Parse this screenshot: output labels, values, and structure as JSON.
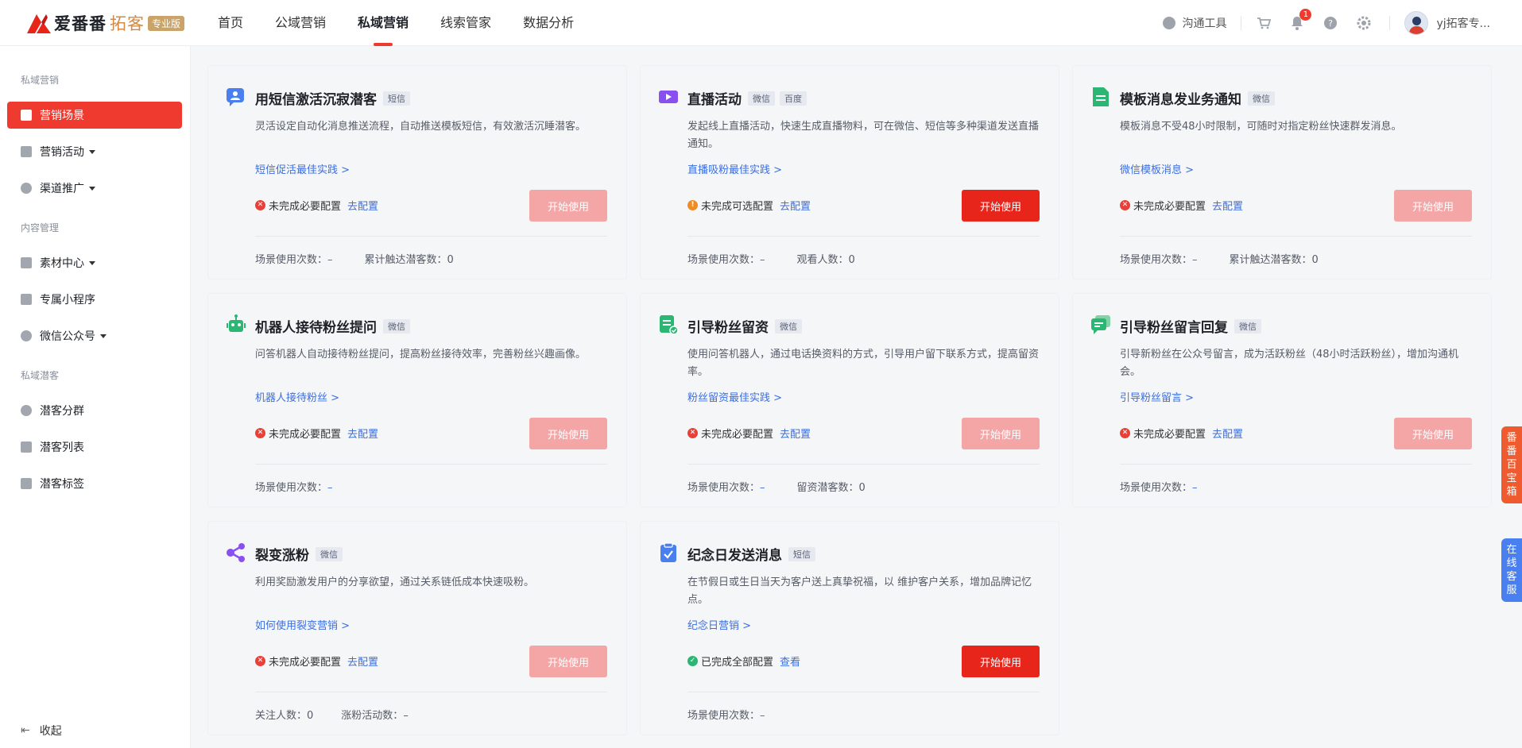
{
  "brand": {
    "name": "爱番番",
    "sub": "拓客",
    "badge": "专业版"
  },
  "nav": [
    "首页",
    "公域营销",
    "私域营销",
    "线索管家",
    "数据分析"
  ],
  "header_right": {
    "tool": "沟通工具",
    "bell_count": "1",
    "user": "yj拓客专..."
  },
  "sidebar": {
    "groups": [
      "私域营销",
      "内容管理",
      "私域潜客"
    ],
    "items": [
      "营销场景",
      "营销活动",
      "渠道推广",
      "素材中心",
      "专属小程序",
      "微信公众号",
      "潜客分群",
      "潜客列表",
      "潜客标签"
    ],
    "collapse": "收起"
  },
  "cards": [
    {
      "title": "用短信激活沉寂潜客",
      "tags": [
        "短信"
      ],
      "desc": "灵活设定自动化消息推送流程，自动推送模板短信，有效激活沉睡潜客。",
      "link": "短信促活最佳实践 >",
      "status": "未完成必要配置",
      "status_link": "去配置",
      "button": "开始使用",
      "stats": [
        {
          "label": "场景使用次数：",
          "value": "–"
        },
        {
          "label": "累计触达潜客数：",
          "value": "0"
        }
      ]
    },
    {
      "title": "直播活动",
      "tags": [
        "微信",
        "百度"
      ],
      "desc": "发起线上直播活动，快速生成直播物料，可在微信、短信等多种渠道发送直播通知。",
      "link": "直播吸粉最佳实践 >",
      "status": "未完成可选配置",
      "status_link": "去配置",
      "button": "开始使用",
      "stats": [
        {
          "label": "场景使用次数：",
          "value": "–"
        },
        {
          "label": "观看人数：",
          "value": "0"
        }
      ]
    },
    {
      "title": "模板消息发业务通知",
      "tags": [
        "微信"
      ],
      "desc": "模板消息不受48小时限制，可随时对指定粉丝快速群发消息。",
      "link": "微信模板消息 >",
      "status": "未完成必要配置",
      "status_link": "去配置",
      "button": "开始使用",
      "stats": [
        {
          "label": "场景使用次数：",
          "value": "–"
        },
        {
          "label": "累计触达潜客数：",
          "value": "0"
        }
      ]
    },
    {
      "title": "机器人接待粉丝提问",
      "tags": [
        "微信"
      ],
      "desc": "问答机器人自动接待粉丝提问，提高粉丝接待效率，完善粉丝兴趣画像。",
      "link": "机器人接待粉丝 >",
      "status": "未完成必要配置",
      "status_link": "去配置",
      "button": "开始使用",
      "stats": [
        {
          "label": "场景使用次数：",
          "value": "–"
        }
      ]
    },
    {
      "title": "引导粉丝留资",
      "tags": [
        "微信"
      ],
      "desc": "使用问答机器人，通过电话换资料的方式，引导用户留下联系方式，提高留资率。",
      "link": "粉丝留资最佳实践 >",
      "status": "未完成必要配置",
      "status_link": "去配置",
      "button": "开始使用",
      "stats": [
        {
          "label": "场景使用次数：",
          "value": "–"
        },
        {
          "label": "留资潜客数：",
          "value": "0"
        }
      ]
    },
    {
      "title": "引导粉丝留言回复",
      "tags": [
        "微信"
      ],
      "desc": "引导新粉丝在公众号留言，成为活跃粉丝（48小时活跃粉丝），增加沟通机会。",
      "link": "引导粉丝留言 >",
      "status": "未完成必要配置",
      "status_link": "去配置",
      "button": "开始使用",
      "stats": [
        {
          "label": "场景使用次数：",
          "value": "–"
        }
      ]
    },
    {
      "title": "裂变涨粉",
      "tags": [
        "微信"
      ],
      "desc": "利用奖励激发用户的分享欲望，通过关系链低成本快速吸粉。",
      "link": "如何使用裂变营销 >",
      "status": "未完成必要配置",
      "status_link": "去配置",
      "button": "开始使用",
      "stats": [
        {
          "label": "关注人数：",
          "value": "0"
        },
        {
          "label": "涨粉活动数：",
          "value": "–"
        }
      ]
    },
    {
      "title": "纪念日发送消息",
      "tags": [
        "短信"
      ],
      "desc": "在节假日或生日当天为客户送上真挚祝福，以 维护客户关系，增加品牌记忆点。",
      "link": "纪念日营销 >",
      "status": "已完成全部配置",
      "status_link": "查看",
      "button": "开始使用",
      "stats": [
        {
          "label": "场景使用次数：",
          "value": "–"
        }
      ]
    }
  ],
  "float_tabs": [
    "番番百宝箱",
    "在线客服"
  ],
  "colors": {
    "accent": "#ef3a2f",
    "link": "#3c6ee0",
    "warn": "#f08a24",
    "ok": "#2bb673"
  }
}
